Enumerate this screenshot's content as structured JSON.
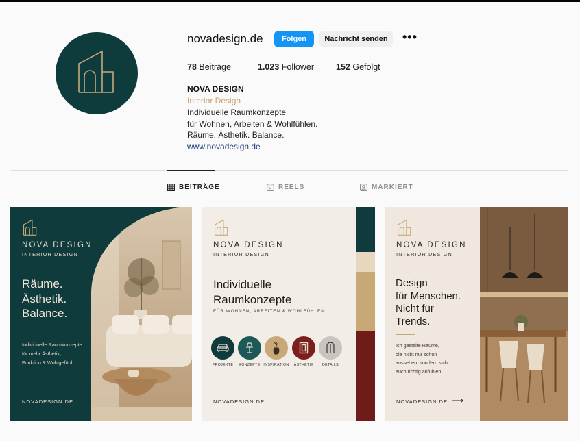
{
  "profile": {
    "username": "novadesign.de",
    "follow_label": "Folgen",
    "message_label": "Nachricht senden",
    "more_label": "•••",
    "stats": {
      "posts_count": "78",
      "posts_label": "Beiträge",
      "followers_count": "1.023",
      "followers_label": "Follower",
      "following_count": "152",
      "following_label": "Gefolgt"
    },
    "bio": {
      "name": "NOVA DESIGN",
      "category": "Interior Design",
      "lines": [
        "Individuelle Raumkonzepte",
        "für Wohnen, Arbeiten & Wohlfühlen.",
        "Räume. Ästhetik. Balance."
      ],
      "link": "www.novadesign.de"
    }
  },
  "tabs": [
    {
      "label": "BEITRÄGE",
      "icon": "grid-icon",
      "active": true
    },
    {
      "label": "REELS",
      "icon": "reels-icon",
      "active": false
    },
    {
      "label": "MARKIERT",
      "icon": "tagged-icon",
      "active": false
    }
  ],
  "posts": [
    {
      "brand_title": "NOVA DESIGN",
      "brand_subtitle": "INTERIOR DESIGN",
      "headline": [
        "Räume.",
        "Ästhetik.",
        "Balance."
      ],
      "body": [
        "Individuelle Raumkonzepte",
        "für mehr Ästhetik,",
        "Funktion & Wohlgefühl."
      ],
      "footer": "NOVADESIGN.DE"
    },
    {
      "brand_title": "NOVA DESIGN",
      "brand_subtitle": "INTERIOR DESIGN",
      "headline": [
        "Individuelle",
        "Raumkonzepte"
      ],
      "tagline": "FÜR WOHNEN, ARBEITEN & WOHLFÜHLEN.",
      "icons": [
        {
          "label": "PROJEKTE",
          "icon": "sofa-icon",
          "color": "#0f3b3c"
        },
        {
          "label": "KONZEPTE",
          "icon": "lamp-icon",
          "color": "#1d5a57"
        },
        {
          "label": "INSPIRATION",
          "icon": "vase-icon",
          "color": "#c9a878"
        },
        {
          "label": "ÄSTHETIK",
          "icon": "frame-icon",
          "color": "#7a1f1d"
        },
        {
          "label": "DETAILS",
          "icon": "arch-icon",
          "color": "#c8c5c0"
        }
      ],
      "stripe_colors": [
        "#0f3b3c",
        "#e8d7bf",
        "#c9a878",
        "#6e1b1a"
      ],
      "footer": "NOVADESIGN.DE"
    },
    {
      "brand_title": "NOVA DESIGN",
      "brand_subtitle": "INTERIOR DESIGN",
      "headline": [
        "Design",
        "für Menschen.",
        "Nicht für",
        "Trends."
      ],
      "body": [
        "Ich gestalte Räume,",
        "die nicht nur schön",
        "aussehen, sondern sich",
        "auch richtig anfühlen."
      ],
      "footer": "NOVADESIGN.DE",
      "arrow": "⟶"
    }
  ],
  "colors": {
    "brand_teal": "#0f3b3c",
    "accent_gold": "#c9a878",
    "follow_blue": "#1495f5",
    "link_blue": "#1f3d77",
    "burgundy": "#6e1b1a"
  }
}
